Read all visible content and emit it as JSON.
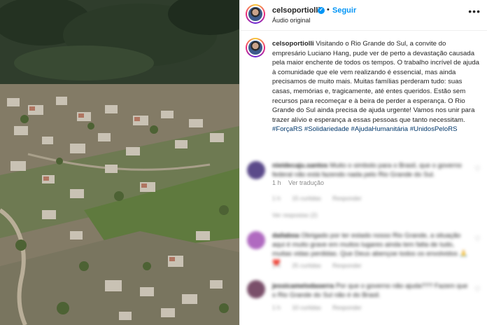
{
  "post": {
    "username": "celsoportiolli",
    "follow_label": "Seguir",
    "separator": "•",
    "audio_label": "Áudio original",
    "more_icon": "more-horizontal-icon"
  },
  "caption": {
    "username": "celsoportiolli",
    "text": "Visitando o Rio Grande do Sul, a convite do empresário Luciano Hang, pude ver de perto a devastação causada pela maior enchente de todos os tempos. O trabalho incrível de ajuda à comunidade que ele vem realizando é essencial, mas ainda precisamos de muito mais. Muitas famílias perderam tudo: suas casas, memórias e, tragicamente, até entes queridos. Estão sem recursos para recomeçar e à beira de perder a esperança. O Rio Grande do Sul ainda precisa de ajuda urgente! Vamos nos unir para trazer alívio e esperança a essas pessoas que tanto necessitam.",
    "hashtags": [
      "#ForçaRS",
      "#Solidariedade",
      "#AjudaHumanitária",
      "#UnidosPeloRS"
    ],
    "time": "1 h",
    "translate_label": "Ver tradução"
  },
  "comments": [
    {
      "avatar_color": "#5b4a8a",
      "username": "nieidecaju.santos",
      "text": "Muito o simbolo para o Brasil, que o governo federal não está fazendo nada pelo Rio Grande do Sul.",
      "time": "1 h",
      "likes": "15 curtidas",
      "reply_label": "Responder",
      "replies": "Ver respostas (2)"
    },
    {
      "avatar_color": "#b06ac0",
      "username": "dailaboa",
      "text": "Obrigado por ter estado nosso Rio Grande, a situação aqui é muito grave em muitos lugares ainda tem falta de tudo, muitas vidas perdidas. Que Deus abençoe todos os envolvidos 🙏❤️",
      "time": "1 h",
      "likes": "25 curtidas",
      "reply_label": "Responder",
      "replies": ""
    },
    {
      "avatar_color": "#7a4f6a",
      "username": "jessicamelodaserra",
      "text": "Por que o governo não ajuda??? Fazem que o Rio Grande do Sul não é do Brasil.",
      "time": "1 h",
      "likes": "10 curtidas",
      "reply_label": "Responder",
      "replies": ""
    }
  ]
}
